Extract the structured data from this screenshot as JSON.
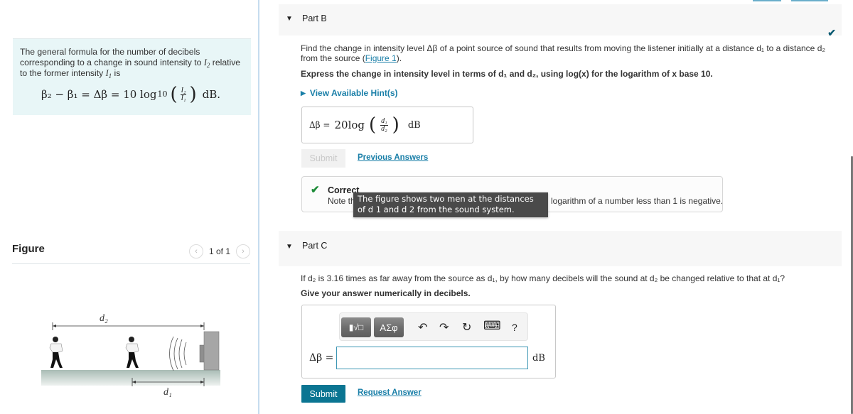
{
  "intro": {
    "text_1": "The general formula for the number of decibels corresponding to a change in sound intensity to ",
    "var_I2": "I",
    "var_I2_sub": "2",
    "text_2": " relative to the former intensity ",
    "var_I1": "I",
    "var_I1_sub": "1",
    "text_3": " is",
    "formula": {
      "lhs": "β₂ − β₁ = Δβ = 10 log",
      "log_base": "10",
      "frac_num": "I₂",
      "frac_den": "I₁",
      "unit": "dB."
    }
  },
  "figure": {
    "title": "Figure",
    "pager_text": "1 of 1",
    "prev_icon": "‹",
    "next_icon": "›",
    "label_d2": "d₂",
    "label_d1": "d₁"
  },
  "part_b": {
    "title": "Part B",
    "status": "correct",
    "question_a": "Find the change in intensity level Δβ of a point source of sound that results from moving the listener initially at a distance d₁ to a distance d₂ from the source (",
    "figure_link": "Figure 1",
    "question_b": ").",
    "instruction": "Express the change in intensity level in terms of d₁ and d₂, using log(x) for the logarithm of x base 10.",
    "hint_label": "View Available Hint(s)",
    "answer": {
      "label": "Δβ =",
      "value": "20log",
      "frac_num": "d₁",
      "frac_den": "d₂",
      "unit": "dB"
    },
    "submit_label": "Submit",
    "previous_answers_label": "Previous Answers",
    "feedback_title": "Correct",
    "feedback_note_head": "Note th",
    "feedback_note_tail": "logarithm of a number less than 1 is negative."
  },
  "tooltip": {
    "text": "The figure shows two men at the distances of d 1 and d 2 from the sound system."
  },
  "part_c": {
    "title": "Part C",
    "question": "If d₂ is 3.16 times as far away from the source as d₁, by how many decibels will the sound at d₂ be changed relative to that at d₁?",
    "instruction": "Give your answer numerically in decibels.",
    "toolbar": {
      "templates_label": "▮√□",
      "symbols_label": "ΑΣφ",
      "undo_icon": "↶",
      "redo_icon": "↷",
      "reset_icon": "↻",
      "keyboard_icon": "⌨",
      "help_label": "?"
    },
    "answer_label": "Δβ =",
    "answer_value": "",
    "unit": "dB",
    "submit_label": "Submit",
    "request_answer_label": "Request Answer"
  },
  "colors": {
    "accent": "#0b7592",
    "link": "#1a7fa8",
    "correct": "#1e8c39",
    "intro_bg": "#e8f6f7"
  }
}
